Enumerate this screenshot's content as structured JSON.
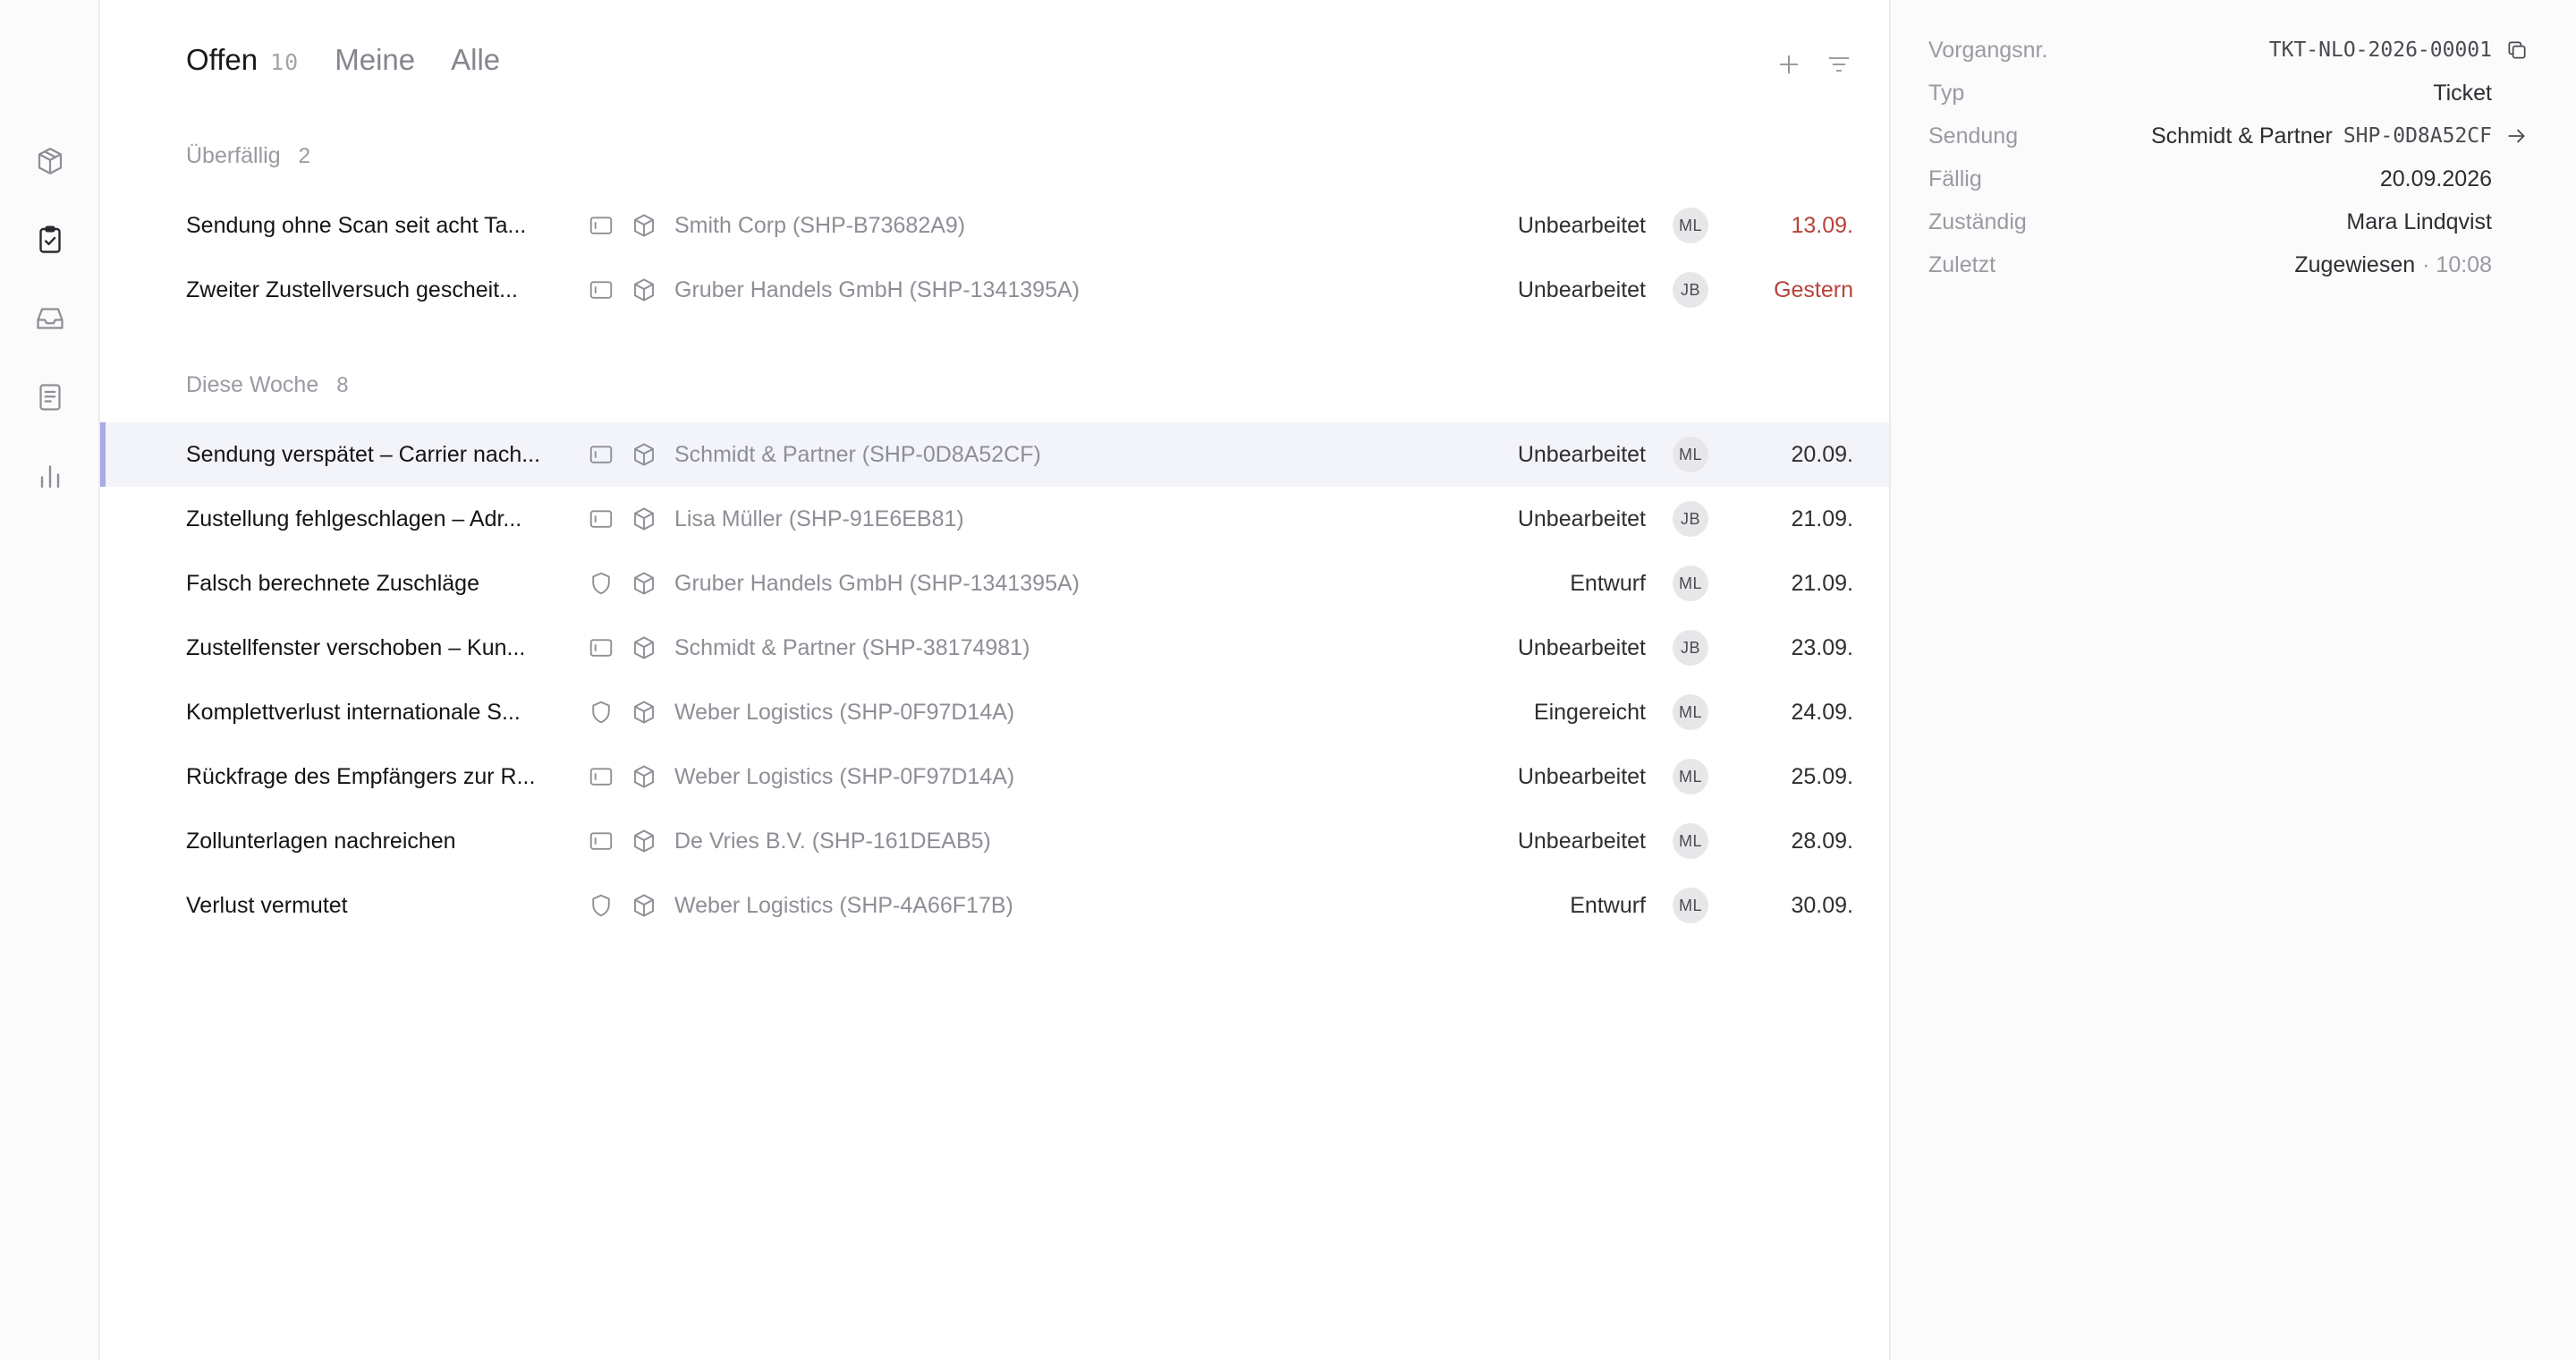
{
  "tabs": [
    {
      "label": "Offen",
      "count": "10"
    },
    {
      "label": "Meine"
    },
    {
      "label": "Alle"
    }
  ],
  "toolbar": {
    "add_icon": "plus-icon",
    "filter_icon": "filter-icon"
  },
  "rail": {
    "items": [
      {
        "icon": "package-icon"
      },
      {
        "icon": "clipboard-check-icon",
        "active": true
      },
      {
        "icon": "inbox-icon"
      },
      {
        "icon": "document-icon"
      },
      {
        "icon": "bar-chart-icon"
      }
    ]
  },
  "groups": {
    "overdue": {
      "label": "Überfällig",
      "count": "2"
    },
    "week": {
      "label": "Diese Woche",
      "count": "8"
    }
  },
  "rows": [
    {
      "title": "Sendung ohne Scan seit acht Ta...",
      "type": "ticket",
      "shipment": "Smith Corp (SHP-B73682A9)",
      "status": "Unbearbeitet",
      "assignee": "ML",
      "due": "13.09.",
      "overdue": true
    },
    {
      "title": "Zweiter Zustellversuch gescheit...",
      "type": "ticket",
      "shipment": "Gruber Handels GmbH (SHP-1341395A)",
      "status": "Unbearbeitet",
      "assignee": "JB",
      "due": "Gestern",
      "overdue": true
    },
    {
      "title": "Sendung verspätet – Carrier nach...",
      "type": "ticket",
      "shipment": "Schmidt & Partner (SHP-0D8A52CF)",
      "status": "Unbearbeitet",
      "assignee": "ML",
      "due": "20.09.",
      "selected": true
    },
    {
      "title": "Zustellung fehlgeschlagen – Adr...",
      "type": "ticket",
      "shipment": "Lisa Müller (SHP-91E6EB81)",
      "status": "Unbearbeitet",
      "assignee": "JB",
      "due": "21.09."
    },
    {
      "title": "Falsch berechnete Zuschläge",
      "type": "claim",
      "shipment": "Gruber Handels GmbH (SHP-1341395A)",
      "status": "Entwurf",
      "assignee": "ML",
      "due": "21.09."
    },
    {
      "title": "Zustellfenster verschoben – Kun...",
      "type": "ticket",
      "shipment": "Schmidt & Partner (SHP-38174981)",
      "status": "Unbearbeitet",
      "assignee": "JB",
      "due": "23.09."
    },
    {
      "title": "Komplettverlust internationale S...",
      "type": "claim",
      "shipment": "Weber Logistics (SHP-0F97D14A)",
      "status": "Eingereicht",
      "assignee": "ML",
      "due": "24.09."
    },
    {
      "title": "Rückfrage des Empfängers zur R...",
      "type": "ticket",
      "shipment": "Weber Logistics (SHP-0F97D14A)",
      "status": "Unbearbeitet",
      "assignee": "ML",
      "due": "25.09."
    },
    {
      "title": "Zollunterlagen nachreichen",
      "type": "ticket",
      "shipment": "De Vries B.V. (SHP-161DEAB5)",
      "status": "Unbearbeitet",
      "assignee": "ML",
      "due": "28.09."
    },
    {
      "title": "Verlust vermutet",
      "type": "claim",
      "shipment": "Weber Logistics (SHP-4A66F17B)",
      "status": "Entwurf",
      "assignee": "ML",
      "due": "30.09."
    }
  ],
  "detail": {
    "number_label": "Vorgangsnr.",
    "number_value": "TKT-NLO-2026-00001",
    "type_label": "Typ",
    "type_value": "Ticket",
    "shipment_label": "Sendung",
    "shipment_name": "Schmidt & Partner",
    "shipment_id": "SHP-0D8A52CF",
    "due_label": "Fällig",
    "due_value": "20.09.2026",
    "assignee_label": "Zuständig",
    "assignee_value": "Mara Lindqvist",
    "last_label": "Zuletzt",
    "last_value": "Zugewiesen",
    "last_time": "· 10:08"
  },
  "colors": {
    "overdue": "#b8423a",
    "selected_bg": "#f3f4fa",
    "selected_bar": "#a9a9e6"
  }
}
